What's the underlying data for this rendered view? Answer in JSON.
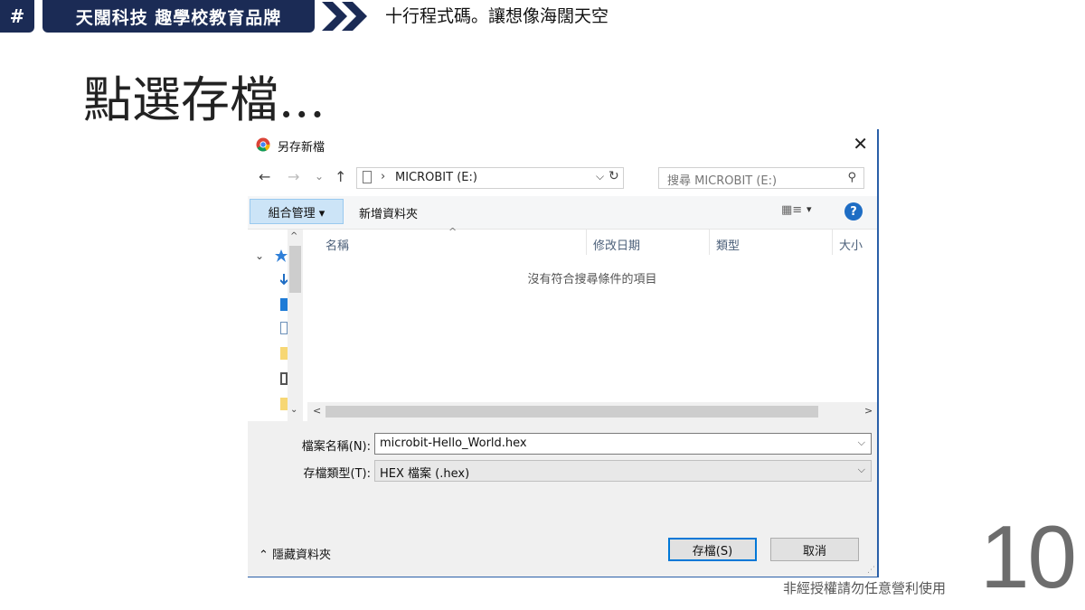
{
  "header": {
    "hash": "#",
    "brand": "天闊科技 趣學校教育品牌",
    "slogan": "十行程式碼。讓想像海闊天空"
  },
  "slide": {
    "title": "點選存檔...",
    "footer_note": "非經授權請勿任意營利使用",
    "page_number": "10"
  },
  "dialog": {
    "title": "另存新檔",
    "close": "✕",
    "nav": {
      "back": "←",
      "forward": "→",
      "recent": "⌄",
      "up": "↑"
    },
    "address": {
      "separator": "›",
      "path": "MICROBIT (E:)",
      "dropdown": "⌵",
      "refresh": "↻"
    },
    "search": {
      "placeholder": "搜尋 MICROBIT (E:)",
      "icon": "⚲"
    },
    "toolbar": {
      "organize": "組合管理 ▾",
      "new_folder": "新增資料夾",
      "view_icon": "▦≡",
      "view_dropdown": "▾",
      "help": "?"
    },
    "columns": [
      "名稱",
      "修改日期",
      "類型",
      "大小"
    ],
    "sort_caret": "^",
    "empty_message": "沒有符合搜尋條件的項目",
    "file_name": {
      "label": "檔案名稱(N):",
      "value": "microbit-Hello_World.hex",
      "chevron": "⌵"
    },
    "file_type": {
      "label": "存檔類型(T):",
      "value": "HEX 檔案 (.hex)",
      "chevron": "⌵"
    },
    "hide_folders": "⌃ 隱藏資料夾",
    "save": "存檔(S)",
    "cancel": "取消",
    "scroll": {
      "up": "^",
      "down": "⌄",
      "left": "<",
      "right": ">"
    },
    "nav_expand": "⌄"
  }
}
